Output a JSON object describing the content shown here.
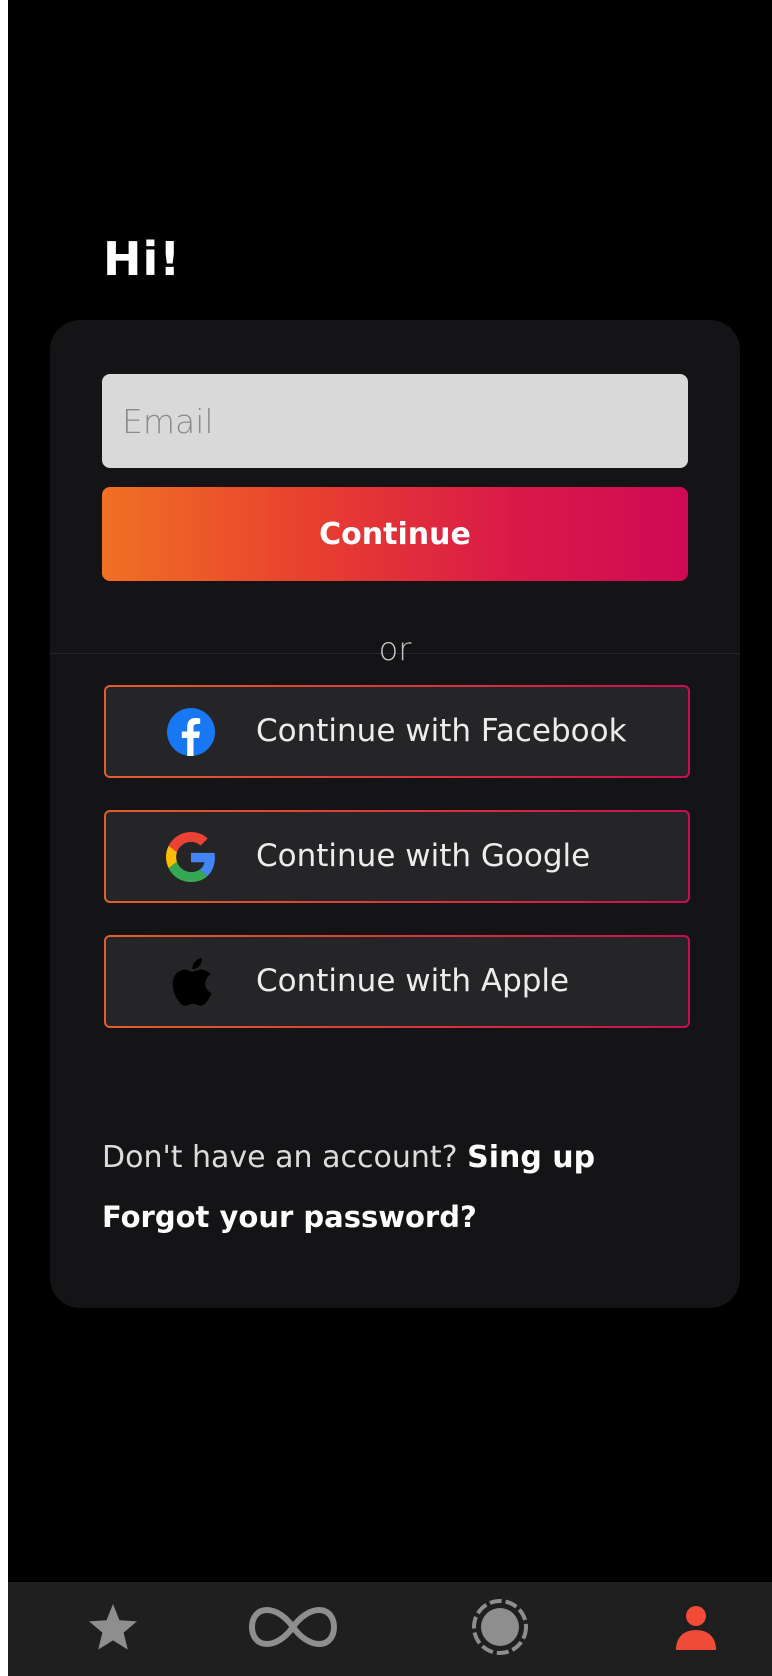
{
  "greeting": "Hi!",
  "email": {
    "placeholder": "Email",
    "value": ""
  },
  "continue_label": "Continue",
  "divider_label": "or",
  "social": [
    {
      "label": "Continue with Facebook",
      "icon": "facebook-icon"
    },
    {
      "label": "Continue with Google",
      "icon": "google-icon"
    },
    {
      "label": "Continue with Apple",
      "icon": "apple-icon"
    }
  ],
  "signup": {
    "prompt": "Don't have an account?",
    "link": "Sing up"
  },
  "forgot_password": "Forgot your password?",
  "nav": [
    {
      "icon": "star-icon",
      "active": false
    },
    {
      "icon": "infinity-icon",
      "active": false
    },
    {
      "icon": "circle-dashed-icon",
      "active": false
    },
    {
      "icon": "profile-icon",
      "active": true
    }
  ],
  "colors": {
    "accent_start": "#f07024",
    "accent_end": "#cf0a55",
    "card_bg": "#141416",
    "nav_bg": "#1f1f1f",
    "nav_inactive": "#8e8e8e",
    "nav_active": "#ef4b36"
  }
}
